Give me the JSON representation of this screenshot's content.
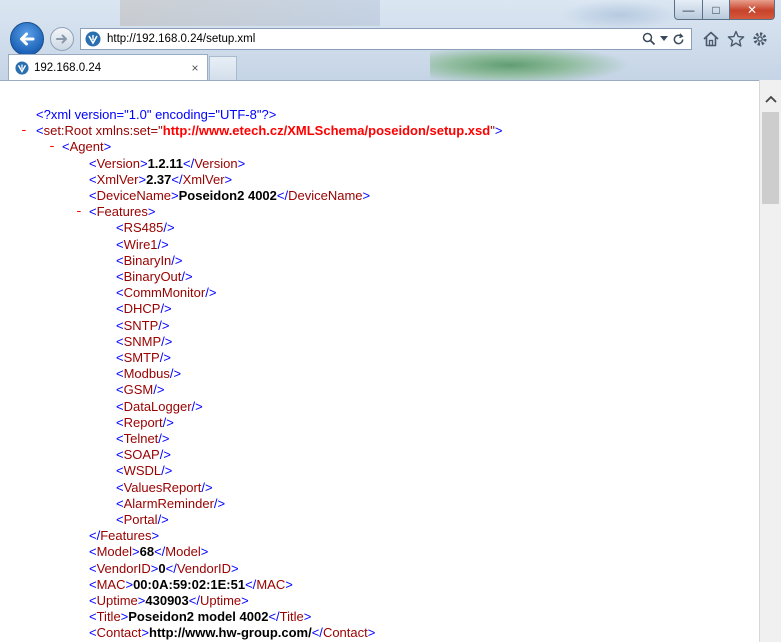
{
  "browser": {
    "url": "http://192.168.0.24/setup.xml",
    "tab_title": "192.168.0.24",
    "tab_close": "×",
    "caption": {
      "minimize": "—",
      "maximize": "□",
      "close": "✕"
    }
  },
  "xml_lines": [
    {
      "indent": 0,
      "minus": false,
      "parts": [
        {
          "c": "pi",
          "t": "<?xml version=\"1.0\" encoding=\"UTF-8\"?>"
        }
      ]
    },
    {
      "indent": 0,
      "minus": true,
      "parts": [
        {
          "c": "b",
          "t": "<"
        },
        {
          "c": "t",
          "t": "set:Root "
        },
        {
          "c": "an",
          "t": "xmlns:set"
        },
        {
          "c": "t",
          "t": "=\""
        },
        {
          "c": "av",
          "t": "http://www.etech.cz/XMLSchema/poseidon/setup.xsd"
        },
        {
          "c": "t",
          "t": "\""
        },
        {
          "c": "b",
          "t": ">"
        }
      ]
    },
    {
      "indent": 1,
      "minus": true,
      "parts": [
        {
          "c": "b",
          "t": "<"
        },
        {
          "c": "t",
          "t": "Agent"
        },
        {
          "c": "b",
          "t": ">"
        }
      ]
    },
    {
      "indent": 2,
      "minus": false,
      "parts": [
        {
          "c": "b",
          "t": "<"
        },
        {
          "c": "t",
          "t": "Version"
        },
        {
          "c": "b",
          "t": ">"
        },
        {
          "c": "v",
          "t": "1.2.11"
        },
        {
          "c": "b",
          "t": "</"
        },
        {
          "c": "t",
          "t": "Version"
        },
        {
          "c": "b",
          "t": ">"
        }
      ]
    },
    {
      "indent": 2,
      "minus": false,
      "parts": [
        {
          "c": "b",
          "t": "<"
        },
        {
          "c": "t",
          "t": "XmlVer"
        },
        {
          "c": "b",
          "t": ">"
        },
        {
          "c": "v",
          "t": "2.37"
        },
        {
          "c": "b",
          "t": "</"
        },
        {
          "c": "t",
          "t": "XmlVer"
        },
        {
          "c": "b",
          "t": ">"
        }
      ]
    },
    {
      "indent": 2,
      "minus": false,
      "parts": [
        {
          "c": "b",
          "t": "<"
        },
        {
          "c": "t",
          "t": "DeviceName"
        },
        {
          "c": "b",
          "t": ">"
        },
        {
          "c": "v",
          "t": "Poseidon2 4002"
        },
        {
          "c": "b",
          "t": "</"
        },
        {
          "c": "t",
          "t": "DeviceName"
        },
        {
          "c": "b",
          "t": ">"
        }
      ]
    },
    {
      "indent": 2,
      "minus": true,
      "parts": [
        {
          "c": "b",
          "t": "<"
        },
        {
          "c": "t",
          "t": "Features"
        },
        {
          "c": "b",
          "t": ">"
        }
      ]
    },
    {
      "indent": 3,
      "minus": false,
      "parts": [
        {
          "c": "b",
          "t": "<"
        },
        {
          "c": "t",
          "t": "RS485"
        },
        {
          "c": "b",
          "t": "/>"
        }
      ]
    },
    {
      "indent": 3,
      "minus": false,
      "parts": [
        {
          "c": "b",
          "t": "<"
        },
        {
          "c": "t",
          "t": "Wire1"
        },
        {
          "c": "b",
          "t": "/>"
        }
      ]
    },
    {
      "indent": 3,
      "minus": false,
      "parts": [
        {
          "c": "b",
          "t": "<"
        },
        {
          "c": "t",
          "t": "BinaryIn"
        },
        {
          "c": "b",
          "t": "/>"
        }
      ]
    },
    {
      "indent": 3,
      "minus": false,
      "parts": [
        {
          "c": "b",
          "t": "<"
        },
        {
          "c": "t",
          "t": "BinaryOut"
        },
        {
          "c": "b",
          "t": "/>"
        }
      ]
    },
    {
      "indent": 3,
      "minus": false,
      "parts": [
        {
          "c": "b",
          "t": "<"
        },
        {
          "c": "t",
          "t": "CommMonitor"
        },
        {
          "c": "b",
          "t": "/>"
        }
      ]
    },
    {
      "indent": 3,
      "minus": false,
      "parts": [
        {
          "c": "b",
          "t": "<"
        },
        {
          "c": "t",
          "t": "DHCP"
        },
        {
          "c": "b",
          "t": "/>"
        }
      ]
    },
    {
      "indent": 3,
      "minus": false,
      "parts": [
        {
          "c": "b",
          "t": "<"
        },
        {
          "c": "t",
          "t": "SNTP"
        },
        {
          "c": "b",
          "t": "/>"
        }
      ]
    },
    {
      "indent": 3,
      "minus": false,
      "parts": [
        {
          "c": "b",
          "t": "<"
        },
        {
          "c": "t",
          "t": "SNMP"
        },
        {
          "c": "b",
          "t": "/>"
        }
      ]
    },
    {
      "indent": 3,
      "minus": false,
      "parts": [
        {
          "c": "b",
          "t": "<"
        },
        {
          "c": "t",
          "t": "SMTP"
        },
        {
          "c": "b",
          "t": "/>"
        }
      ]
    },
    {
      "indent": 3,
      "minus": false,
      "parts": [
        {
          "c": "b",
          "t": "<"
        },
        {
          "c": "t",
          "t": "Modbus"
        },
        {
          "c": "b",
          "t": "/>"
        }
      ]
    },
    {
      "indent": 3,
      "minus": false,
      "parts": [
        {
          "c": "b",
          "t": "<"
        },
        {
          "c": "t",
          "t": "GSM"
        },
        {
          "c": "b",
          "t": "/>"
        }
      ]
    },
    {
      "indent": 3,
      "minus": false,
      "parts": [
        {
          "c": "b",
          "t": "<"
        },
        {
          "c": "t",
          "t": "DataLogger"
        },
        {
          "c": "b",
          "t": "/>"
        }
      ]
    },
    {
      "indent": 3,
      "minus": false,
      "parts": [
        {
          "c": "b",
          "t": "<"
        },
        {
          "c": "t",
          "t": "Report"
        },
        {
          "c": "b",
          "t": "/>"
        }
      ]
    },
    {
      "indent": 3,
      "minus": false,
      "parts": [
        {
          "c": "b",
          "t": "<"
        },
        {
          "c": "t",
          "t": "Telnet"
        },
        {
          "c": "b",
          "t": "/>"
        }
      ]
    },
    {
      "indent": 3,
      "minus": false,
      "parts": [
        {
          "c": "b",
          "t": "<"
        },
        {
          "c": "t",
          "t": "SOAP"
        },
        {
          "c": "b",
          "t": "/>"
        }
      ]
    },
    {
      "indent": 3,
      "minus": false,
      "parts": [
        {
          "c": "b",
          "t": "<"
        },
        {
          "c": "t",
          "t": "WSDL"
        },
        {
          "c": "b",
          "t": "/>"
        }
      ]
    },
    {
      "indent": 3,
      "minus": false,
      "parts": [
        {
          "c": "b",
          "t": "<"
        },
        {
          "c": "t",
          "t": "ValuesReport"
        },
        {
          "c": "b",
          "t": "/>"
        }
      ]
    },
    {
      "indent": 3,
      "minus": false,
      "parts": [
        {
          "c": "b",
          "t": "<"
        },
        {
          "c": "t",
          "t": "AlarmReminder"
        },
        {
          "c": "b",
          "t": "/>"
        }
      ]
    },
    {
      "indent": 3,
      "minus": false,
      "parts": [
        {
          "c": "b",
          "t": "<"
        },
        {
          "c": "t",
          "t": "Portal"
        },
        {
          "c": "b",
          "t": "/>"
        }
      ]
    },
    {
      "indent": 2,
      "minus": false,
      "parts": [
        {
          "c": "b",
          "t": "</"
        },
        {
          "c": "t",
          "t": "Features"
        },
        {
          "c": "b",
          "t": ">"
        }
      ]
    },
    {
      "indent": 2,
      "minus": false,
      "parts": [
        {
          "c": "b",
          "t": "<"
        },
        {
          "c": "t",
          "t": "Model"
        },
        {
          "c": "b",
          "t": ">"
        },
        {
          "c": "v",
          "t": "68"
        },
        {
          "c": "b",
          "t": "</"
        },
        {
          "c": "t",
          "t": "Model"
        },
        {
          "c": "b",
          "t": ">"
        }
      ]
    },
    {
      "indent": 2,
      "minus": false,
      "parts": [
        {
          "c": "b",
          "t": "<"
        },
        {
          "c": "t",
          "t": "VendorID"
        },
        {
          "c": "b",
          "t": ">"
        },
        {
          "c": "v",
          "t": "0"
        },
        {
          "c": "b",
          "t": "</"
        },
        {
          "c": "t",
          "t": "VendorID"
        },
        {
          "c": "b",
          "t": ">"
        }
      ]
    },
    {
      "indent": 2,
      "minus": false,
      "parts": [
        {
          "c": "b",
          "t": "<"
        },
        {
          "c": "t",
          "t": "MAC"
        },
        {
          "c": "b",
          "t": ">"
        },
        {
          "c": "v",
          "t": "00:0A:59:02:1E:51"
        },
        {
          "c": "b",
          "t": "</"
        },
        {
          "c": "t",
          "t": "MAC"
        },
        {
          "c": "b",
          "t": ">"
        }
      ]
    },
    {
      "indent": 2,
      "minus": false,
      "parts": [
        {
          "c": "b",
          "t": "<"
        },
        {
          "c": "t",
          "t": "Uptime"
        },
        {
          "c": "b",
          "t": ">"
        },
        {
          "c": "v",
          "t": "430903"
        },
        {
          "c": "b",
          "t": "</"
        },
        {
          "c": "t",
          "t": "Uptime"
        },
        {
          "c": "b",
          "t": ">"
        }
      ]
    },
    {
      "indent": 2,
      "minus": false,
      "parts": [
        {
          "c": "b",
          "t": "<"
        },
        {
          "c": "t",
          "t": "Title"
        },
        {
          "c": "b",
          "t": ">"
        },
        {
          "c": "v",
          "t": "Poseidon2 model 4002"
        },
        {
          "c": "b",
          "t": "</"
        },
        {
          "c": "t",
          "t": "Title"
        },
        {
          "c": "b",
          "t": ">"
        }
      ]
    },
    {
      "indent": 2,
      "minus": false,
      "parts": [
        {
          "c": "b",
          "t": "<"
        },
        {
          "c": "t",
          "t": "Contact"
        },
        {
          "c": "b",
          "t": ">"
        },
        {
          "c": "v",
          "t": "http://www.hw-group.com/"
        },
        {
          "c": "b",
          "t": "</"
        },
        {
          "c": "t",
          "t": "Contact"
        },
        {
          "c": "b",
          "t": ">"
        }
      ]
    }
  ]
}
